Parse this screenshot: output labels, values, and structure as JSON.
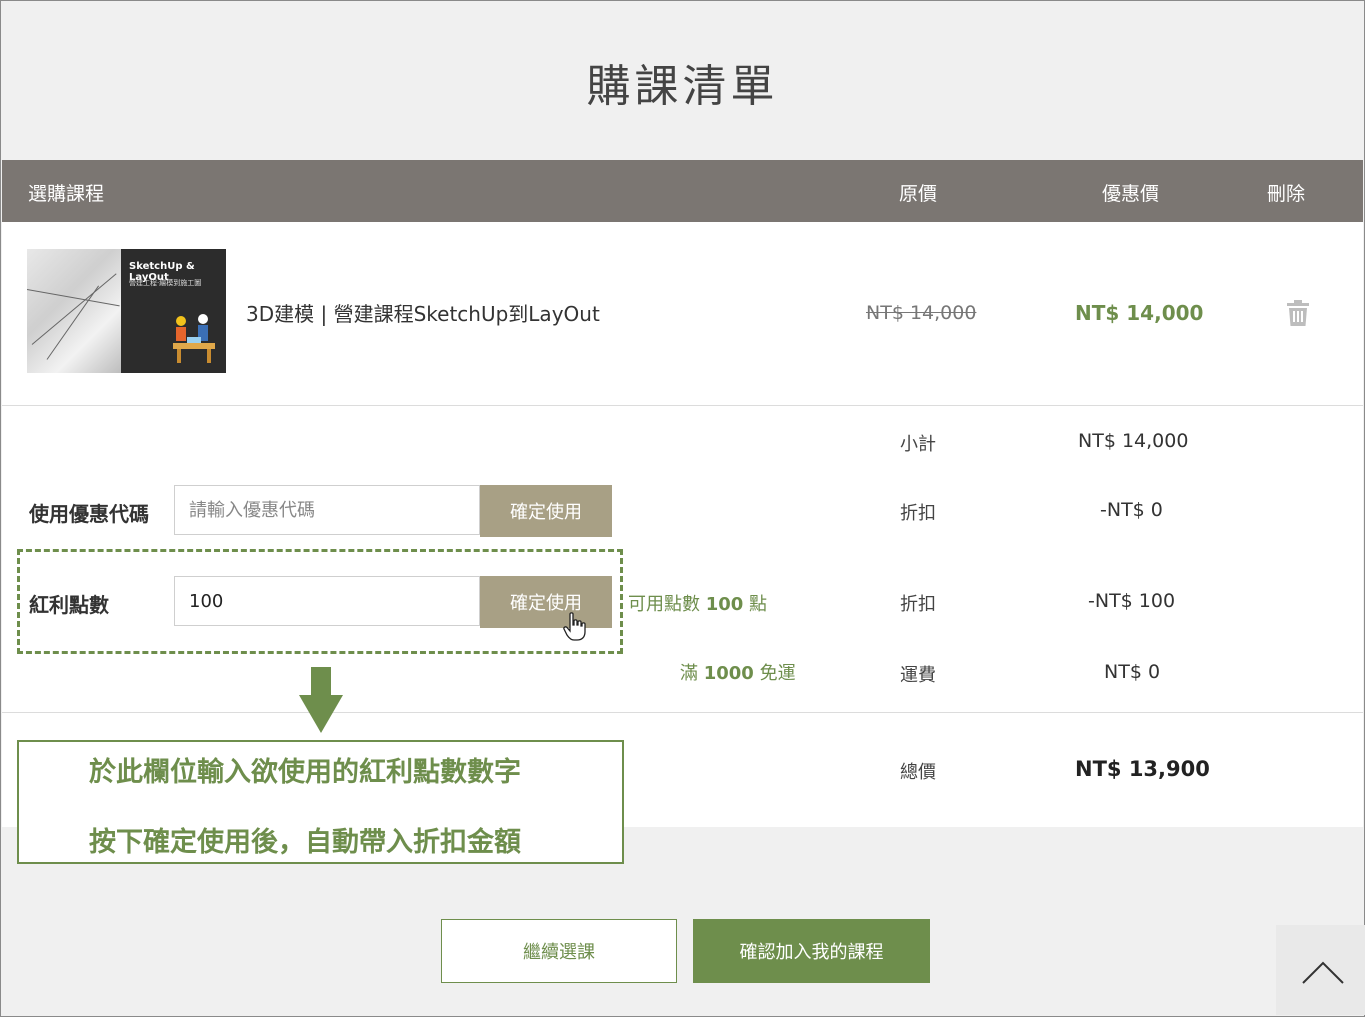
{
  "page": {
    "title": "購課清單"
  },
  "table": {
    "headers": {
      "course": "選購課程",
      "original": "原價",
      "sale": "優惠價",
      "delete": "刪除"
    }
  },
  "item": {
    "name": "3D建模 | 營建課程SketchUp到LayOut",
    "original_price": "NT$ 14,000",
    "sale_price": "NT$ 14,000",
    "thumbnail": {
      "title": "SketchUp & LayOut",
      "subtitle": "營建工程‧繪模到施工圖"
    }
  },
  "coupon": {
    "label": "使用優惠代碼",
    "placeholder": "請輸入優惠代碼",
    "value": "",
    "button": "確定使用"
  },
  "points": {
    "label": "紅利點數",
    "value": "100",
    "button": "確定使用",
    "available_prefix": "可用點數",
    "available_count": "100",
    "available_suffix": "點"
  },
  "shipping_note": {
    "prefix": "滿",
    "amount": "1000",
    "suffix": "免運"
  },
  "summary": {
    "subtotal_label": "小計",
    "subtotal_value": "NT$ 14,000",
    "coupon_discount_label": "折扣",
    "coupon_discount_value": "-NT$ 0",
    "points_discount_label": "折扣",
    "points_discount_value": "-NT$ 100",
    "shipping_label": "運費",
    "shipping_value": "NT$ 0",
    "total_label": "總價",
    "total_value": "NT$ 13,900"
  },
  "callout": {
    "line1": "於此欄位輸入欲使用的紅利點數數字",
    "line2": "按下確定使用後，自動帶入折扣金額"
  },
  "actions": {
    "continue": "繼續選課",
    "confirm": "確認加入我的課程"
  },
  "colors": {
    "accent": "#6e8e4c",
    "header_bg": "#7b7672",
    "apply_btn": "#a8a085"
  },
  "icons": {
    "delete": "trash-icon",
    "scroll_top": "chevron-up-icon",
    "cursor": "hand-pointer-icon",
    "callout_arrow": "arrow-down-icon"
  }
}
